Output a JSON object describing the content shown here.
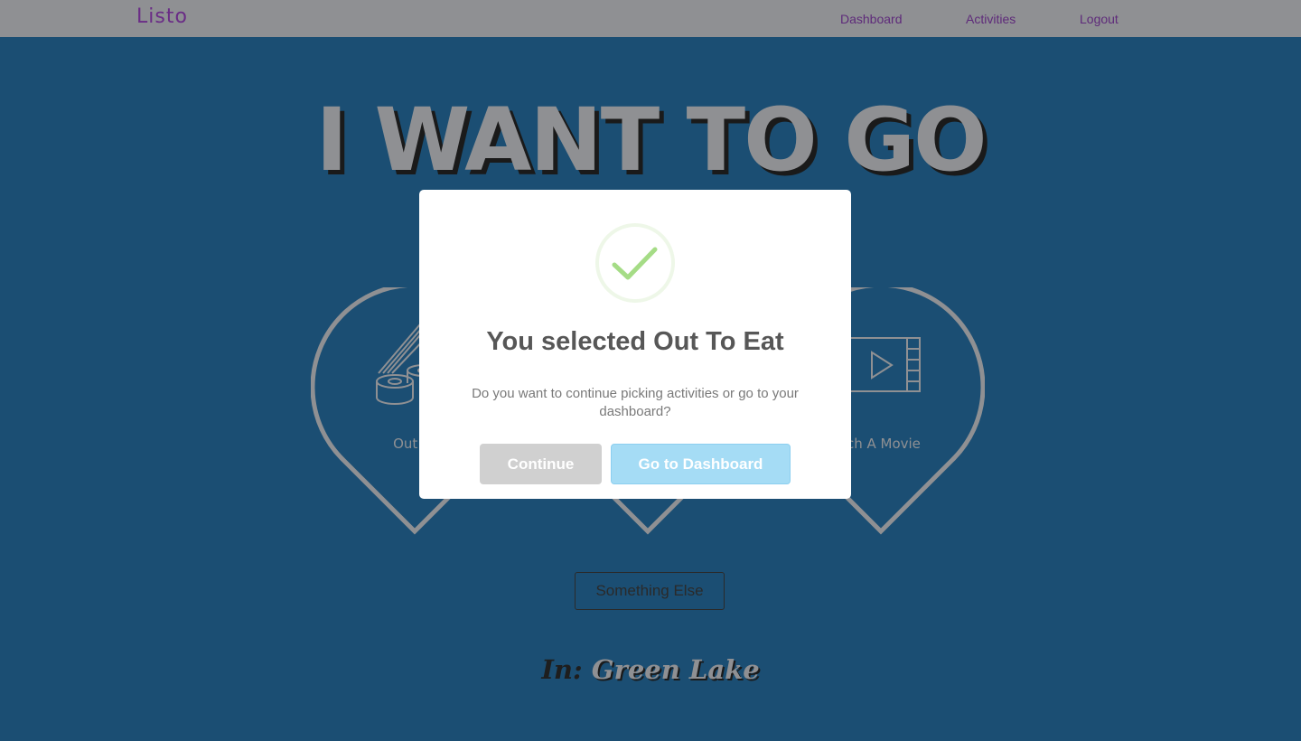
{
  "navbar": {
    "brand": "Listo",
    "links": [
      {
        "label": "Dashboard"
      },
      {
        "label": "Activities"
      },
      {
        "label": "Logout"
      }
    ]
  },
  "main": {
    "headline": "I WANT TO GO",
    "activities": [
      {
        "label": "Out To",
        "icon": "sushi-icon"
      },
      {
        "label": "",
        "icon": ""
      },
      {
        "label": "tch A Movie",
        "icon": "film-play-icon"
      }
    ],
    "something_else_label": "Something Else",
    "location": {
      "prefix": "In:",
      "name": "Green Lake"
    }
  },
  "modal": {
    "icon": "checkmark-success-icon",
    "title": "You selected Out To Eat",
    "text": "Do you want to continue picking activities or go to your dashboard?",
    "continue_label": "Continue",
    "dashboard_label": "Go to Dashboard"
  },
  "colors": {
    "background": "#1b4e73",
    "navbar": "#8f9093",
    "brand": "#6a2c86",
    "nav_link": "#5e2a7a",
    "success": "#a5dc86",
    "button_continue": "#d0d0d0",
    "button_dashboard": "#a5dcf5"
  }
}
